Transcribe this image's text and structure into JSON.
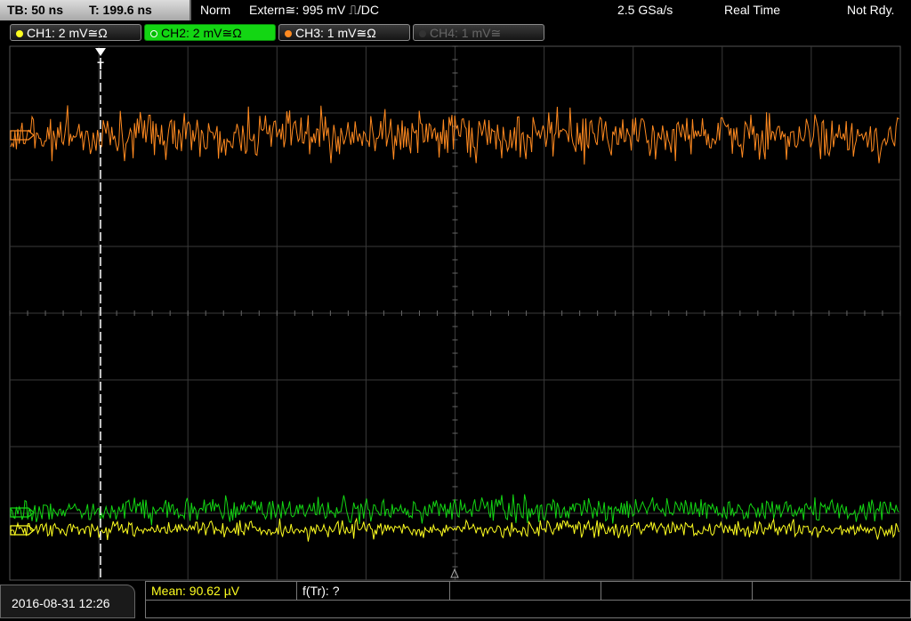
{
  "status": {
    "timebase": "TB: 50 ns",
    "trigger_time": "T: 199.6 ns",
    "mode": "Norm",
    "trigger": "Extern≅: 995 mV ⎍/DC",
    "sample_rate": "2.5 GSa/s",
    "acq": "Real Time",
    "state": "Not Rdy."
  },
  "channels": [
    {
      "label": "CH1: 2 mV≅Ω",
      "color": "#ffff20"
    },
    {
      "label": "CH2: 2 mV≅Ω",
      "color": "#13d613"
    },
    {
      "label": "CH3: 1 mV≅Ω",
      "color": "#ff8a20"
    },
    {
      "label": "CH4: 1 mV≅",
      "color": "#555555"
    }
  ],
  "trigger_marker": "T",
  "bottom": {
    "datetime": "2016-08-31 12:26",
    "mean": "Mean: 90.62 µV",
    "ftr": "f(Tr): ?"
  },
  "colors": {
    "ch1": "#ffff20",
    "ch2": "#13d613",
    "ch3": "#ff8a20",
    "grid": "#3a3a3a",
    "trigger_line": "#ffffff"
  }
}
